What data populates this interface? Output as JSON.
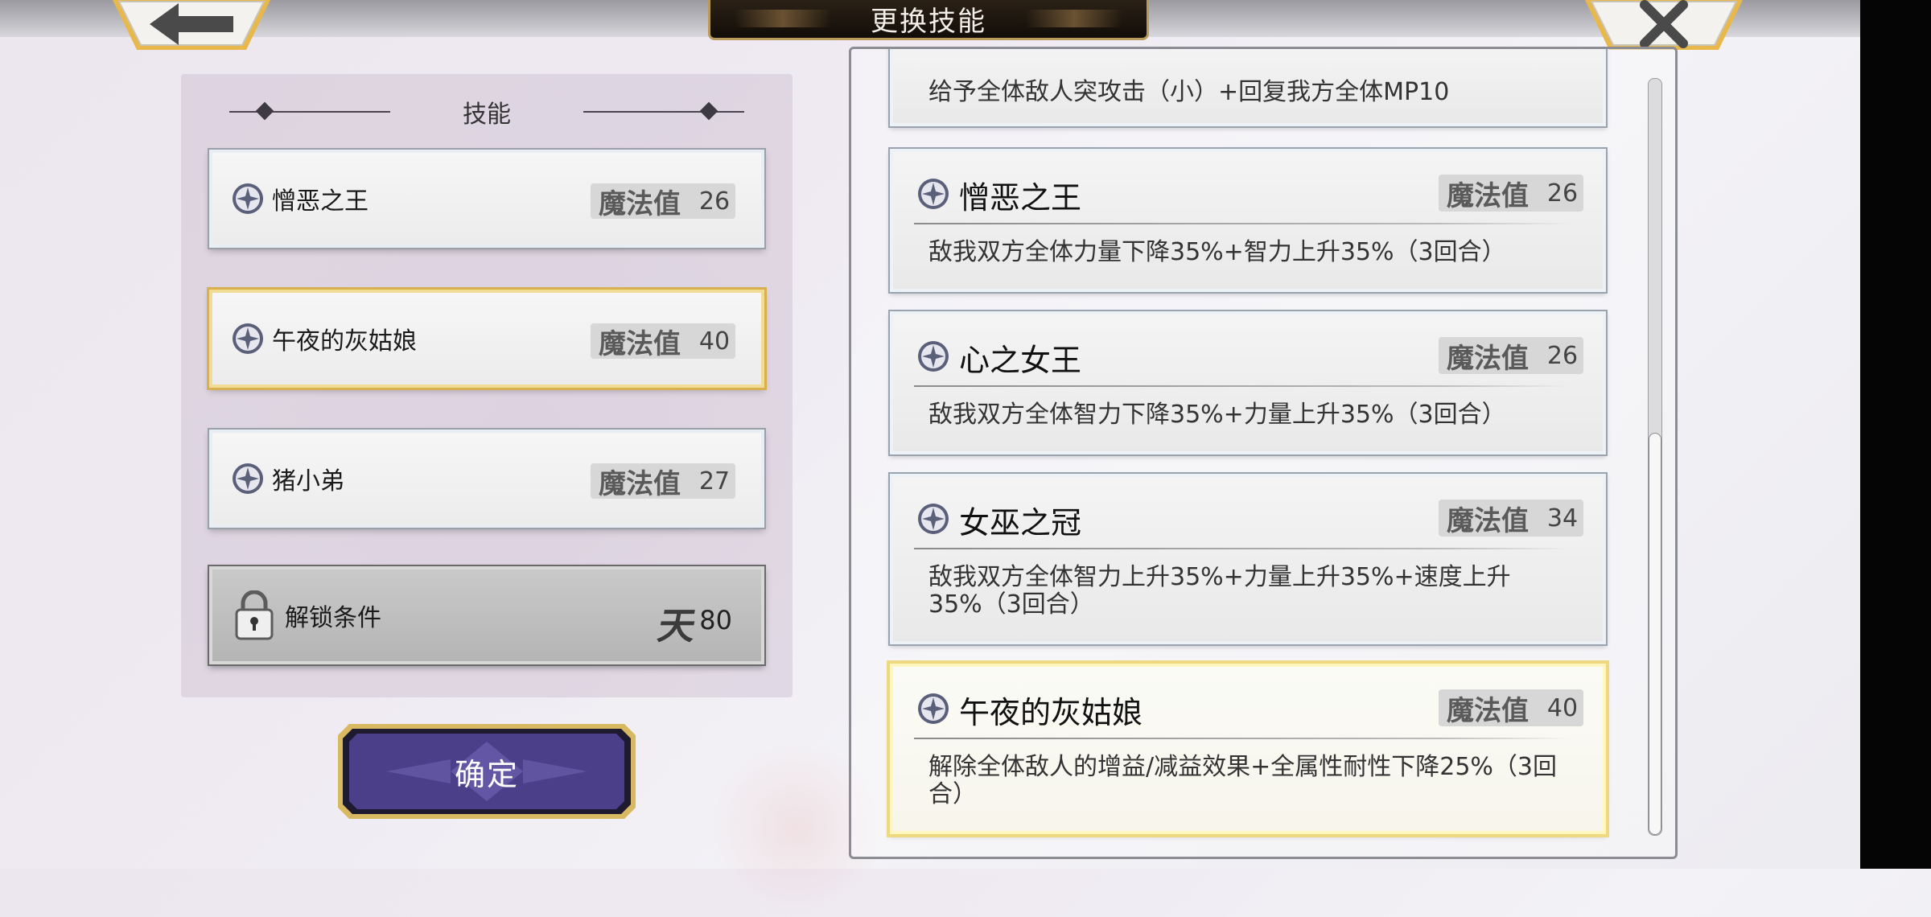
{
  "header": {
    "title": "更换技能",
    "back_icon": "arrow-left-icon",
    "close_icon": "close-icon"
  },
  "left_panel": {
    "title": "技能",
    "slots": [
      {
        "name": "憎恶之王",
        "mp_label": "魔法值",
        "mp": "26",
        "selected": false
      },
      {
        "name": "午夜的灰姑娘",
        "mp_label": "魔法值",
        "mp": "40",
        "selected": true
      },
      {
        "name": "猪小弟",
        "mp_label": "魔法值",
        "mp": "27",
        "selected": false
      }
    ],
    "locked_slot": {
      "label": "解锁条件",
      "badge": "天",
      "value": "80",
      "icon": "lock-icon"
    },
    "confirm_label": "确定"
  },
  "right_panel": {
    "partial_card_desc": "给予全体敌人突攻击（小）+回复我方全体MP10",
    "cards": [
      {
        "name": "憎恶之王",
        "mp_label": "魔法值",
        "mp": "26",
        "desc": "敌我双方全体力量下降35%+智力上升35%（3回合）"
      },
      {
        "name": "心之女王",
        "mp_label": "魔法值",
        "mp": "26",
        "desc": "敌我双方全体智力下降35%+力量上升35%（3回合）"
      },
      {
        "name": "女巫之冠",
        "mp_label": "魔法值",
        "mp": "34",
        "desc": "敌我双方全体智力上升35%+力量上升35%+速度上升35%（3回合）"
      },
      {
        "name": "午夜的灰姑娘",
        "mp_label": "魔法值",
        "mp": "40",
        "desc": "解除全体敌人的增益/减益效果+全属性耐性下降25%（3回合）"
      }
    ]
  },
  "colors": {
    "selected_border": "#d8b050",
    "confirm_button": "#4a3a8c",
    "title_plate": "#1a130c"
  }
}
